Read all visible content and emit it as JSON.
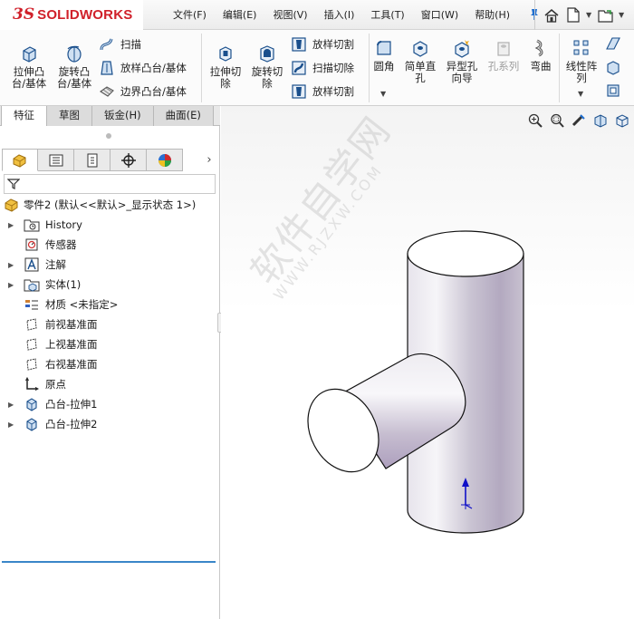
{
  "app": {
    "logo_prefix": "3S",
    "logo_name": "SOLIDWORKS"
  },
  "menu": {
    "items": [
      "文件(F)",
      "编辑(E)",
      "视图(V)",
      "插入(I)",
      "工具(T)",
      "窗口(W)",
      "帮助(H)"
    ]
  },
  "ribbon": {
    "extrude_boss": "拉伸凸\n台/基体",
    "revolve_boss": "旋转凸\n台/基体",
    "sweep": "扫描",
    "loft_boss": "放样凸台/基体",
    "boundary_boss": "边界凸台/基体",
    "extrude_cut": "拉伸切\n除",
    "revolve_cut": "旋转切\n除",
    "loft_cut_1": "放样切割",
    "sweep_cut": "扫描切除",
    "loft_cut_2": "放样切割",
    "fillet": "圆角",
    "simple_hole": "简单直\n孔",
    "hole_wizard": "异型孔\n向导",
    "hole_series": "孔系列",
    "wrap": "弯曲",
    "linear_pattern": "线性阵\n列"
  },
  "tabs": [
    {
      "label": "特征",
      "active": true
    },
    {
      "label": "草图",
      "active": false
    },
    {
      "label": "钣金(H)",
      "active": false
    },
    {
      "label": "曲面(E)",
      "active": false
    }
  ],
  "tree": {
    "root": "零件2  (默认<<默认>_显示状态 1>)",
    "items": [
      {
        "label": "History",
        "expandable": true,
        "icon": "history-folder-icon"
      },
      {
        "label": "传感器",
        "expandable": false,
        "icon": "sensor-icon"
      },
      {
        "label": "注解",
        "expandable": true,
        "icon": "annotation-icon"
      },
      {
        "label": "实体(1)",
        "expandable": true,
        "icon": "solid-body-icon"
      },
      {
        "label": "材质 <未指定>",
        "expandable": false,
        "icon": "material-icon"
      },
      {
        "label": "前视基准面",
        "expandable": false,
        "icon": "plane-icon"
      },
      {
        "label": "上视基准面",
        "expandable": false,
        "icon": "plane-icon"
      },
      {
        "label": "右视基准面",
        "expandable": false,
        "icon": "plane-icon"
      },
      {
        "label": "原点",
        "expandable": false,
        "icon": "origin-icon"
      },
      {
        "label": "凸台-拉伸1",
        "expandable": true,
        "icon": "boss-extrude-icon"
      },
      {
        "label": "凸台-拉伸2",
        "expandable": true,
        "icon": "boss-extrude-icon"
      }
    ]
  },
  "watermark": {
    "text": "软件自学网",
    "url": "WWW.RJZXW.COM"
  },
  "colors": {
    "brand": "#d0202a",
    "accent": "#1f6fd0",
    "tree_end_marker": "#3a86c8"
  }
}
